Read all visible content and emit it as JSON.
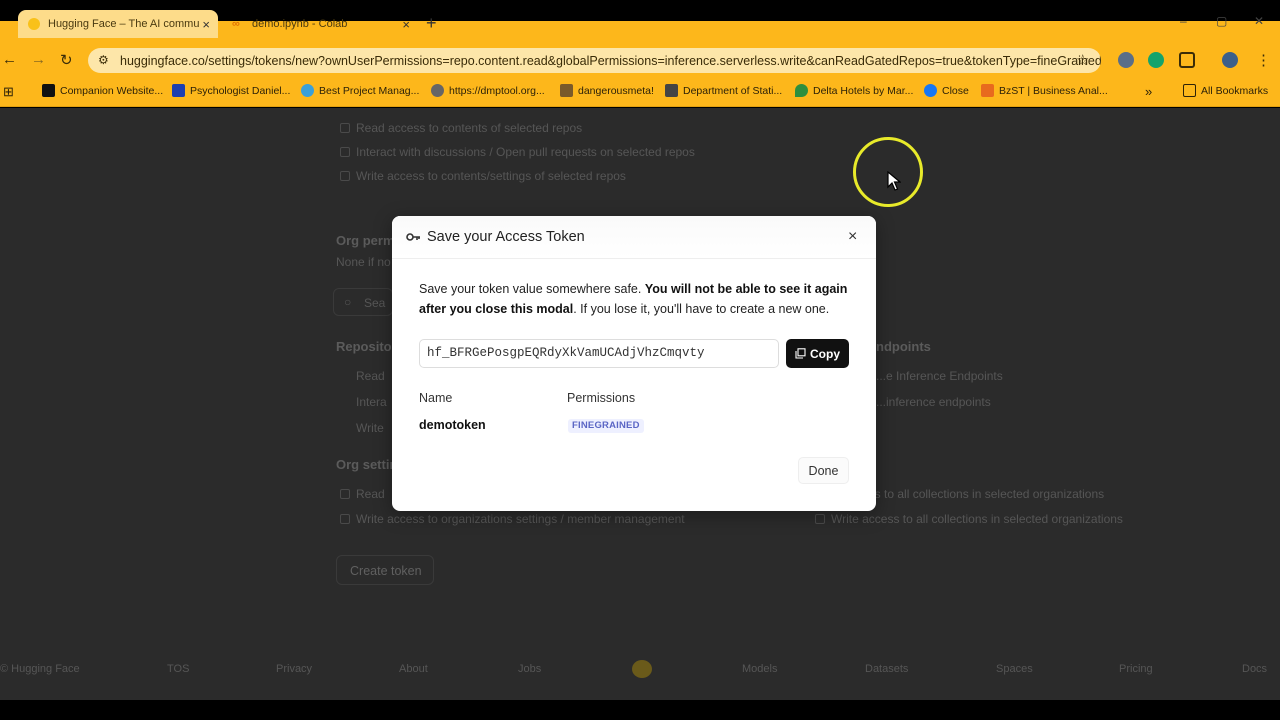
{
  "browser": {
    "tabs": [
      {
        "title": "Hugging Face – The AI commu",
        "close": "×"
      },
      {
        "title": "demo.ipynb - Colab",
        "close": "×"
      }
    ],
    "new_tab": "+",
    "url": "huggingface.co/settings/tokens/new?ownUserPermissions=repo.content.read&globalPermissions=inference.serverless.write&canReadGatedRepos=true&tokenType=fineGrained",
    "bookmarks": [
      "Companion Website...",
      "Psychologist Daniel...",
      "Best Project Manag...",
      "https://dmptool.org...",
      "dangerousmeta!",
      "Department of Stati...",
      "Delta Hotels by Mar...",
      "Close",
      "BzST | Business Anal..."
    ],
    "bookmarks_more": "»",
    "all_bookmarks": "All Bookmarks"
  },
  "background": {
    "repo_perms": [
      "Read access to contents of selected repos",
      "Interact with discussions / Open pull requests on selected repos",
      "Write access to contents/settings of selected repos"
    ],
    "org_perms_heading": "Org perm",
    "org_perms_sub": "None if no",
    "search_placeholder": "Sea",
    "repositories_heading": "Repositor",
    "repo_rows": [
      "Read",
      "Intera",
      "Write"
    ],
    "endpoints_heading": "ndpoints",
    "endpoint_rows": [
      "...e Inference Endpoints",
      "...inference endpoints"
    ],
    "org_settings_heading": "Org settin",
    "org_left_rows": [
      "Read",
      "Write access to organizations settings / member management"
    ],
    "org_right_rows": [
      "...ccess to all collections in selected organizations",
      "Write access to all collections in selected organizations"
    ],
    "create_token": "Create token",
    "footer": [
      "© Hugging Face",
      "TOS",
      "Privacy",
      "About",
      "Jobs",
      "Models",
      "Datasets",
      "Spaces",
      "Pricing",
      "Docs"
    ]
  },
  "modal": {
    "title": "Save your Access Token",
    "close": "×",
    "text_1": "Save your token value somewhere safe. ",
    "text_bold": "You will not be able to see it again after you close this modal",
    "text_2": ". If you lose it, you'll have to create a new one.",
    "token_value": "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",
    "copy_label": "Copy",
    "col_name": "Name",
    "col_permissions": "Permissions",
    "token_name": "demotoken",
    "token_type": "FINEGRAINED",
    "done_label": "Done"
  },
  "colors": {
    "chrome": "#fdb71b",
    "overlay": "#2b2b2b",
    "badge_text": "#5b66c5",
    "cursor_ring": "#e8ea2a"
  },
  "icons": [
    "key-icon",
    "copy-icon",
    "close-icon",
    "star-icon",
    "back-icon",
    "forward-icon",
    "reload-icon",
    "cursor-icon"
  ]
}
